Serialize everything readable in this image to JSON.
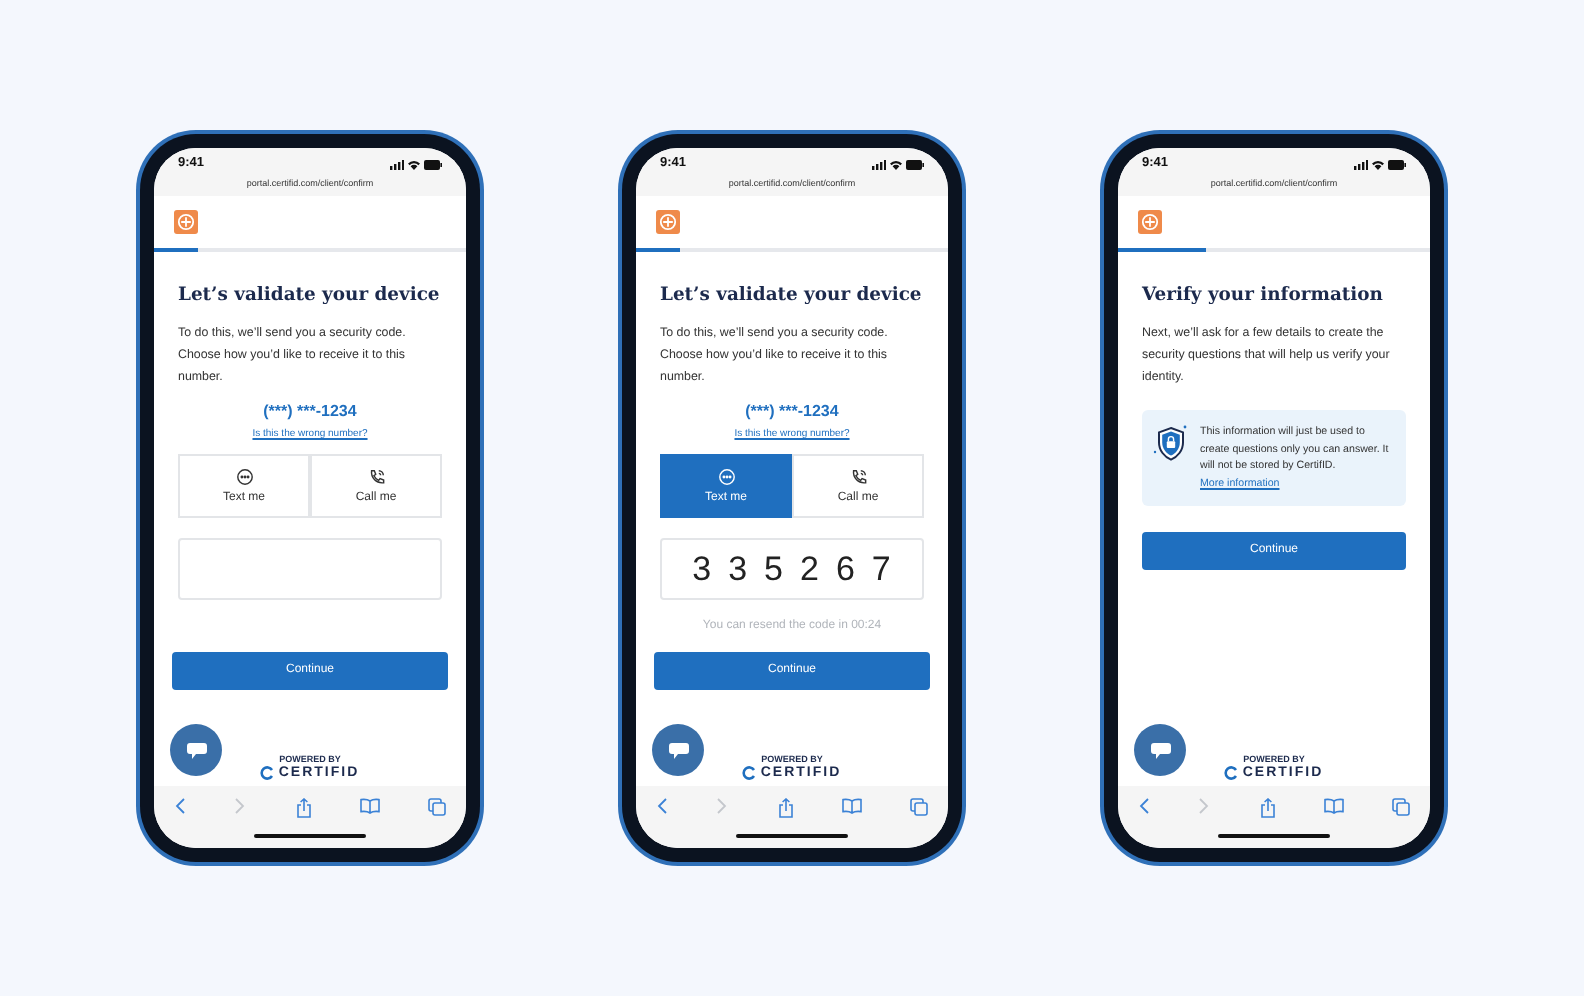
{
  "phones": [
    {
      "kind": "validate",
      "status_time": "9:41",
      "url": "portal.certifid.com/client/confirm",
      "progress": {
        "level": 0.14
      },
      "title": "Let’s validate your device",
      "body": "To do this, we’ll send you a security code. Choose how you’d like to receive it to this number.",
      "phone_number": "(***) ***-1234",
      "wrong_number_link": "Is this the wrong number?",
      "methods": [
        {
          "label": "Text me",
          "selected": false
        },
        {
          "label": "Call me",
          "selected": false
        }
      ],
      "continue_button": "Continue",
      "powered_by": "POWERED BY",
      "brand": "CERTIFID"
    },
    {
      "kind": "validate",
      "status_time": "9:41",
      "url": "portal.certifid.com/client/confirm",
      "progress": {
        "level": 0.14
      },
      "title": "Let’s validate your device",
      "body": "To do this, we’ll send you a security code. Choose how you’d like to receive it to this number.",
      "phone_number": "(***) ***-1234",
      "wrong_number_link": "Is this the wrong number?",
      "methods": [
        {
          "label": "Text me",
          "selected": true
        },
        {
          "label": "Call me",
          "selected": false
        }
      ],
      "code": "335267",
      "resend_text": "You can resend the code in 00:24",
      "continue_button": "Continue",
      "powered_by": "POWERED BY",
      "brand": "CERTIFID"
    },
    {
      "kind": "verify",
      "status_time": "9:41",
      "url": "portal.certifid.com/client/confirm",
      "progress": {
        "level": 0.28
      },
      "title": "Verify your information",
      "body": "Next, we’ll ask for a few details to create the security questions that will help us verify your identity.",
      "notice": {
        "text": "This information will just be used to create questions only you can answer. It will not be stored by CertifID.",
        "link": "More information"
      },
      "continue_button": "Continue",
      "powered_by": "POWERED BY",
      "brand": "CERTIFID"
    }
  ]
}
